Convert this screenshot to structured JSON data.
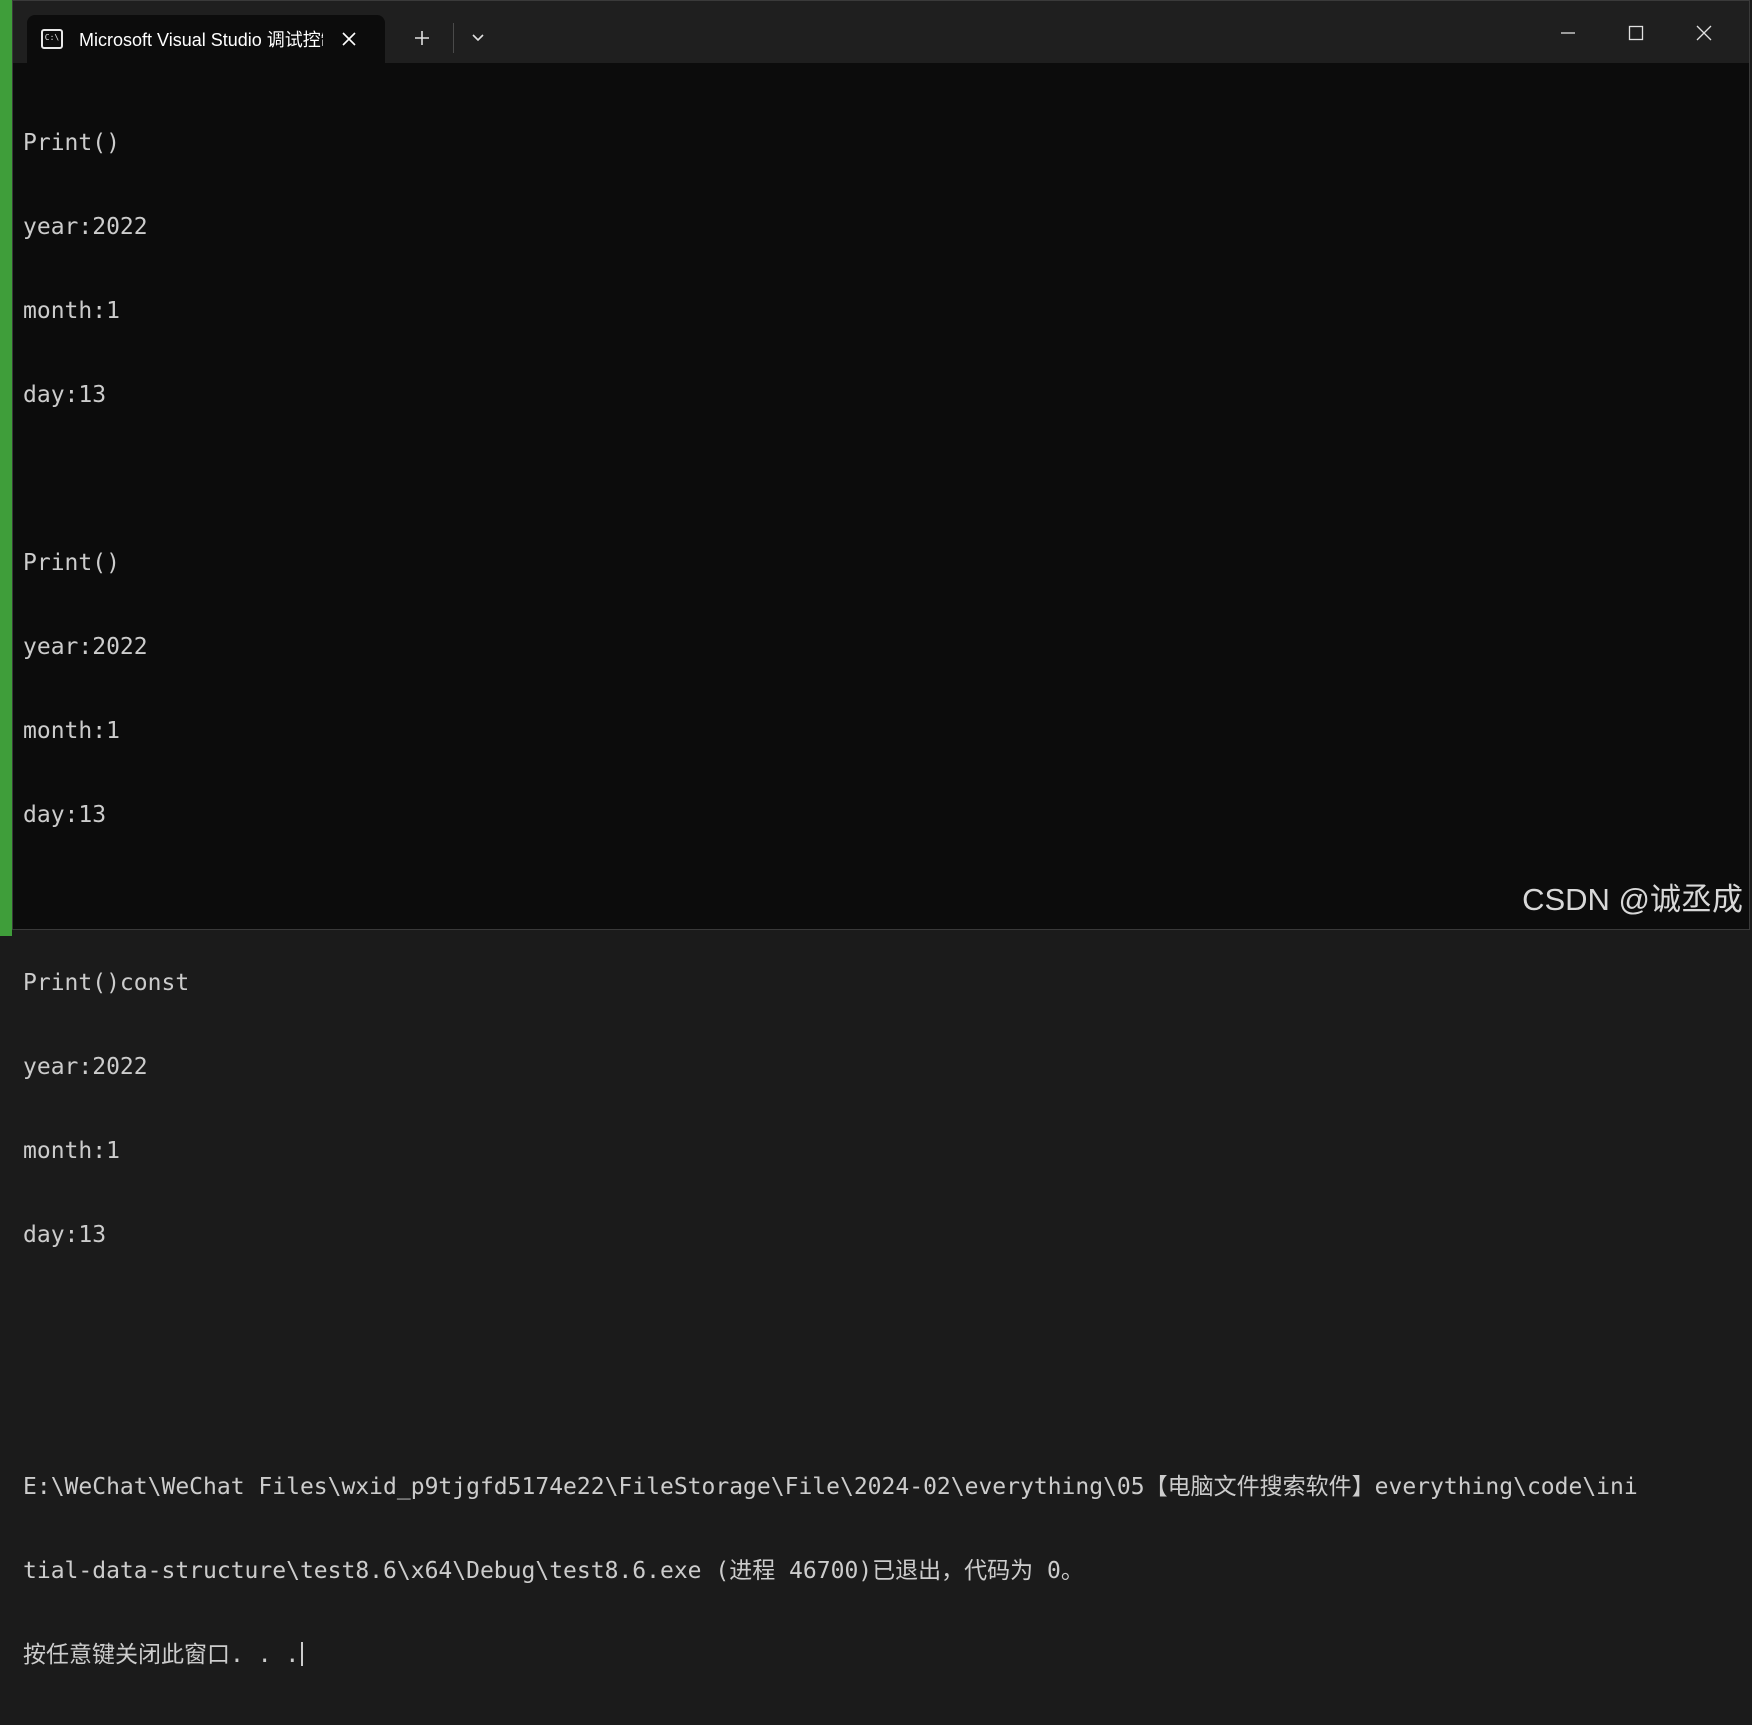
{
  "titlebar": {
    "tab_title": "Microsoft Visual Studio 调试控制台",
    "tab_icon_text": "C:\\"
  },
  "console": {
    "lines": [
      "Print()",
      "year:2022",
      "month:1",
      "day:13",
      "",
      "Print()",
      "year:2022",
      "month:1",
      "day:13",
      "",
      "Print()const",
      "year:2022",
      "month:1",
      "day:13",
      "",
      "",
      "E:\\WeChat\\WeChat Files\\wxid_p9tjgfd5174e22\\FileStorage\\File\\2024-02\\everything\\05【电脑文件搜索软件】everything\\code\\ini",
      "tial-data-structure\\test8.6\\x64\\Debug\\test8.6.exe (进程 46700)已退出，代码为 0。",
      "按任意键关闭此窗口. . ."
    ]
  },
  "watermark": "CSDN @诚丞成",
  "colors": {
    "console_bg": "#0c0c0c",
    "titlebar_bg": "#1f1f1f",
    "text": "#cccccc",
    "left_strip": "#3f9e3a"
  }
}
